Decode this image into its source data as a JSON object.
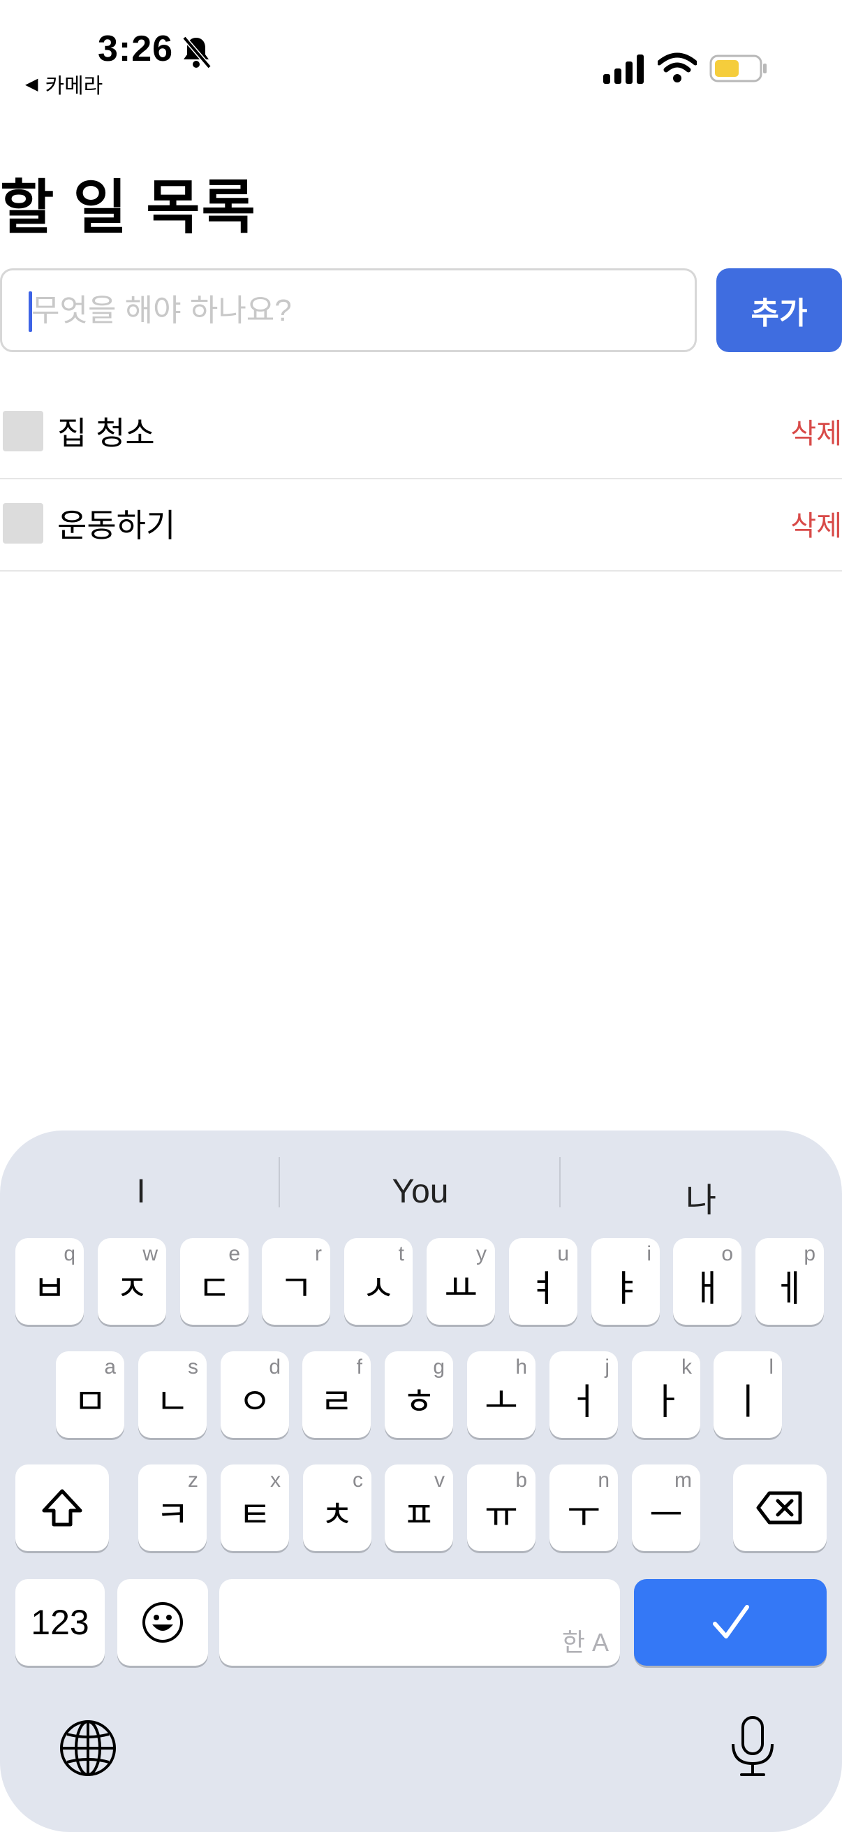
{
  "status_bar": {
    "time": "3:26",
    "back_label": "카메라",
    "back_arrow": "◀",
    "icons": [
      "bell-slash-icon",
      "cellular-signal-icon",
      "wifi-icon",
      "battery-icon"
    ]
  },
  "page": {
    "title": "할 일 목록"
  },
  "input": {
    "placeholder": "무엇을 해야 하나요?",
    "value": ""
  },
  "add_button": {
    "label": "추가",
    "color": "#3f6de0"
  },
  "todos": [
    {
      "text": "집 청소",
      "delete_label": "삭제",
      "checked": false
    },
    {
      "text": "운동하기",
      "delete_label": "삭제",
      "checked": false
    }
  ],
  "keyboard": {
    "suggestions": [
      "I",
      "You",
      "나"
    ],
    "row1": [
      {
        "jamo": "ㅂ",
        "hint": "q"
      },
      {
        "jamo": "ㅈ",
        "hint": "w"
      },
      {
        "jamo": "ㄷ",
        "hint": "e"
      },
      {
        "jamo": "ㄱ",
        "hint": "r"
      },
      {
        "jamo": "ㅅ",
        "hint": "t"
      },
      {
        "jamo": "ㅛ",
        "hint": "y"
      },
      {
        "jamo": "ㅕ",
        "hint": "u"
      },
      {
        "jamo": "ㅑ",
        "hint": "i"
      },
      {
        "jamo": "ㅐ",
        "hint": "o"
      },
      {
        "jamo": "ㅔ",
        "hint": "p"
      }
    ],
    "row2": [
      {
        "jamo": "ㅁ",
        "hint": "a"
      },
      {
        "jamo": "ㄴ",
        "hint": "s"
      },
      {
        "jamo": "ㅇ",
        "hint": "d"
      },
      {
        "jamo": "ㄹ",
        "hint": "f"
      },
      {
        "jamo": "ㅎ",
        "hint": "g"
      },
      {
        "jamo": "ㅗ",
        "hint": "h"
      },
      {
        "jamo": "ㅓ",
        "hint": "j"
      },
      {
        "jamo": "ㅏ",
        "hint": "k"
      },
      {
        "jamo": "ㅣ",
        "hint": "l"
      }
    ],
    "row3": [
      {
        "jamo": "ㅋ",
        "hint": "z"
      },
      {
        "jamo": "ㅌ",
        "hint": "x"
      },
      {
        "jamo": "ㅊ",
        "hint": "c"
      },
      {
        "jamo": "ㅍ",
        "hint": "v"
      },
      {
        "jamo": "ㅠ",
        "hint": "b"
      },
      {
        "jamo": "ㅜ",
        "hint": "n"
      },
      {
        "jamo": "ㅡ",
        "hint": "m"
      }
    ],
    "numbers_label": "123",
    "space_label": "한 A",
    "done_icon": "checkmark-icon",
    "done_color": "#3478f6",
    "bottom_icons": [
      "globe-icon",
      "microphone-icon"
    ]
  }
}
